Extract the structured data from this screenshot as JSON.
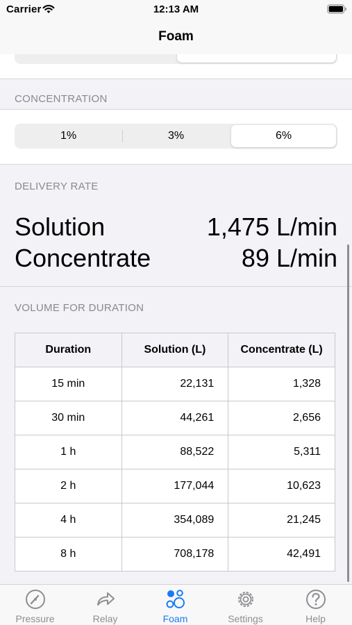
{
  "status_bar": {
    "carrier": "Carrier",
    "time": "12:13 AM"
  },
  "nav": {
    "title": "Foam"
  },
  "top_segment": {
    "partial_left": "(.,...)",
    "partial_right": "(.,...)"
  },
  "concentration": {
    "header": "CONCENTRATION",
    "options": [
      "1%",
      "3%",
      "6%"
    ],
    "selected": "6%"
  },
  "delivery_rate": {
    "header": "DELIVERY RATE",
    "solution_label": "Solution",
    "solution_value": "1,475 L/min",
    "concentrate_label": "Concentrate",
    "concentrate_value": "89 L/min"
  },
  "volume": {
    "header": "VOLUME FOR DURATION",
    "columns": [
      "Duration",
      "Solution (L)",
      "Concentrate (L)"
    ],
    "rows": [
      [
        "15 min",
        "22,131",
        "1,328"
      ],
      [
        "30 min",
        "44,261",
        "2,656"
      ],
      [
        "1 h",
        "88,522",
        "5,311"
      ],
      [
        "2 h",
        "177,044",
        "10,623"
      ],
      [
        "4 h",
        "354,089",
        "21,245"
      ],
      [
        "8 h",
        "708,178",
        "42,491"
      ]
    ]
  },
  "tabs": [
    {
      "label": "Pressure",
      "icon": "gauge-icon"
    },
    {
      "label": "Relay",
      "icon": "relay-arrow-icon"
    },
    {
      "label": "Foam",
      "icon": "foam-bubbles-icon",
      "active": true
    },
    {
      "label": "Settings",
      "icon": "gear-icon"
    },
    {
      "label": "Help",
      "icon": "question-circle-icon"
    }
  ],
  "colors": {
    "accent": "#1a7cf5",
    "inactive": "#8e8e93",
    "section_text": "#8a8a8e"
  }
}
